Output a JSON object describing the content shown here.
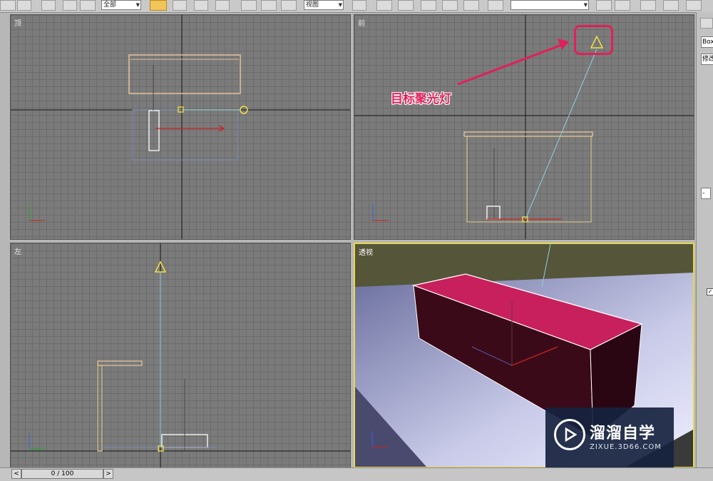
{
  "toolbar": {
    "selection_filter": "全部",
    "ref_coord": "视图",
    "named_selection": ""
  },
  "viewports": {
    "top": {
      "label": "顶"
    },
    "front": {
      "label": "前"
    },
    "left": {
      "label": "左"
    },
    "perspective": {
      "label": "透视"
    }
  },
  "annotation": {
    "label": "目标聚光灯",
    "color": "#e0205a"
  },
  "command_panel": {
    "object_name": "Box",
    "modifier_list": "修改"
  },
  "timeline": {
    "frame": "0 / 100",
    "prev_icon": "chevron-left-icon",
    "next_icon": "chevron-right-icon"
  },
  "watermark": {
    "name": "溜溜自学",
    "url": "ZIXUE.3D66.COM"
  },
  "colors": {
    "box_wire": "#e6c39a",
    "light_cone": "#f0e040",
    "target_line": "#8fd0e0",
    "active_border": "#e8d84a",
    "box_top": "#c8205c",
    "box_side": "#3a0a18"
  }
}
